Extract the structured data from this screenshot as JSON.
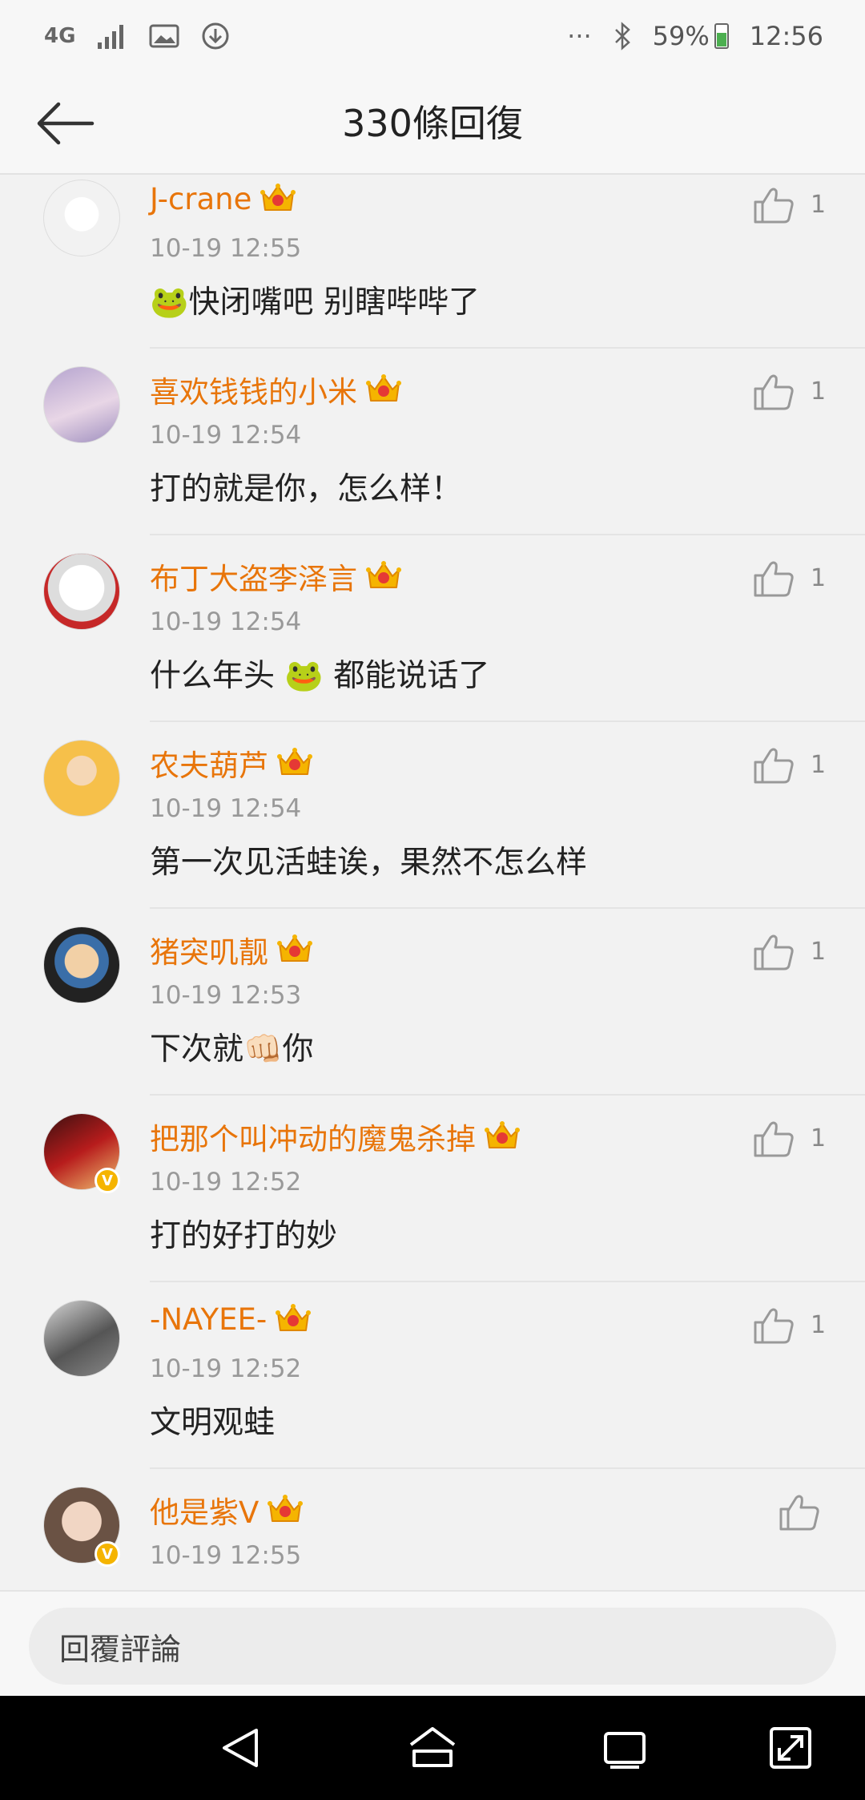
{
  "status_bar": {
    "network": "4G",
    "more": "···",
    "battery": "59%",
    "time": "12:56"
  },
  "header": {
    "title": "330條回復"
  },
  "comments": [
    {
      "user": "J-crane",
      "time": "10-19 12:55",
      "text": "🐸快闭嘴吧 别瞎哔哔了",
      "likes": "1",
      "verified": false
    },
    {
      "user": "喜欢钱钱的小米",
      "time": "10-19 12:54",
      "text": "打的就是你，怎么样！",
      "likes": "1",
      "verified": false
    },
    {
      "user": "布丁大盗李泽言",
      "time": "10-19 12:54",
      "text": "什么年头 🐸 都能说话了",
      "likes": "1",
      "verified": false
    },
    {
      "user": "农夫葫芦",
      "time": "10-19 12:54",
      "text": "第一次见活蛙诶，果然不怎么样",
      "likes": "1",
      "verified": false
    },
    {
      "user": "猪突叽靓",
      "time": "10-19 12:53",
      "text": "下次就👊🏻你",
      "likes": "1",
      "verified": false
    },
    {
      "user": "把那个叫冲动的魔鬼杀掉",
      "time": "10-19 12:52",
      "text": "打的好打的妙",
      "likes": "1",
      "verified": true
    },
    {
      "user": "-NAYEE-",
      "time": "10-19 12:52",
      "text": "文明观蛙",
      "likes": "1",
      "verified": false
    },
    {
      "user": "他是紫V",
      "time": "10-19 12:55",
      "text": "",
      "likes": "",
      "verified": true
    }
  ],
  "reply": {
    "placeholder": "回覆評論"
  },
  "icons": {
    "back": "arrow-left-icon",
    "like": "thumbs-up-icon",
    "crown": "crown-badge-icon"
  },
  "colors": {
    "username": "#e8750a",
    "verified_badge": "#f5b400",
    "nav_background": "#000000"
  }
}
